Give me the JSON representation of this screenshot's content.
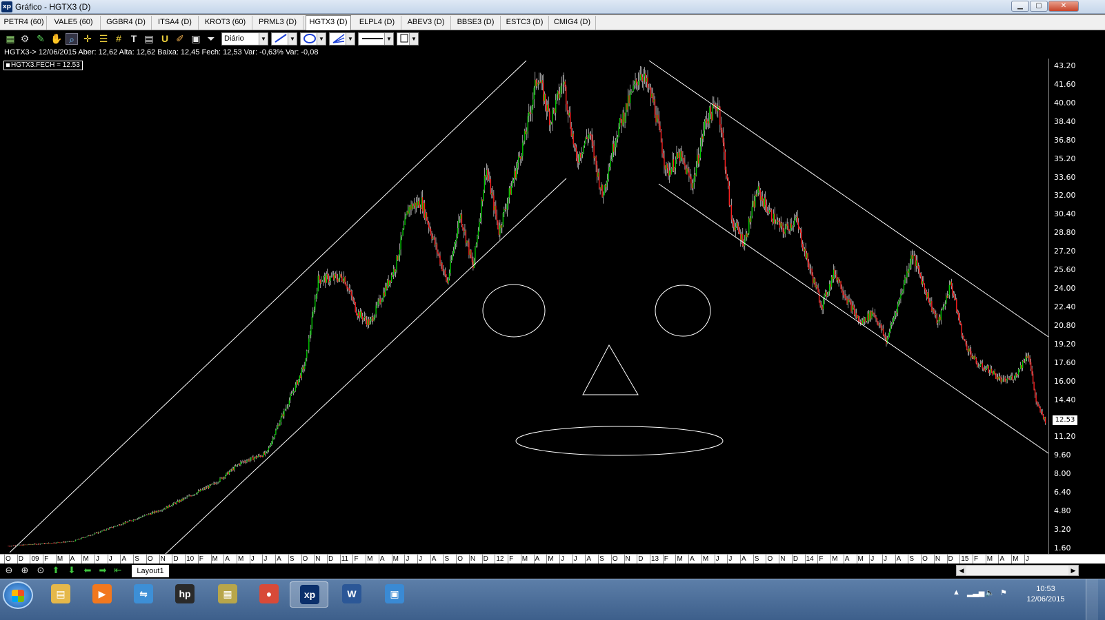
{
  "window": {
    "app_logo": "xp",
    "title": "Gráfico - HGTX3 (D)",
    "controls": [
      "minimize",
      "maximize",
      "close"
    ]
  },
  "tabs": [
    {
      "label": "PETR4 (60)",
      "active": false
    },
    {
      "label": "VALE5 (60)",
      "active": false
    },
    {
      "label": "GGBR4 (D)",
      "active": false
    },
    {
      "label": "ITSA4 (D)",
      "active": false
    },
    {
      "label": "KROT3 (60)",
      "active": false
    },
    {
      "label": "PRML3 (D)",
      "active": false
    },
    {
      "label": "HGTX3 (D)",
      "active": true
    },
    {
      "label": "ELPL4 (D)",
      "active": false
    },
    {
      "label": "ABEV3 (D)",
      "active": false
    },
    {
      "label": "BBSE3 (D)",
      "active": false
    },
    {
      "label": "ESTC3 (D)",
      "active": false
    },
    {
      "label": "CMIG4 (D)",
      "active": false
    }
  ],
  "toolbar": {
    "tools": [
      "chart-icon",
      "gear-icon",
      "pencil-icon",
      "hand-icon",
      "magnifier-icon",
      "crosshair-icon",
      "fibonacci-icon",
      "grid-icon",
      "text-icon",
      "calculator-icon",
      "magnet-icon",
      "brush-icon",
      "clipboard-icon",
      "filter-icon"
    ],
    "periodicity": "Diário"
  },
  "chart": {
    "info_line": "HGTX3-> 12/06/2015 Aber: 12,62 Alta: 12,62 Baixa: 12,45 Fech: 12,53 Var: -0,63% Var: -0,08",
    "legend": "HGTX3.FECH = 12.53",
    "last_price": "12.53",
    "colors": {
      "up": "#00cc00",
      "down": "#ff2020",
      "drawing": "#ffffff",
      "background": "#000000"
    }
  },
  "chart_data": {
    "type": "candlestick",
    "symbol": "HGTX3",
    "periodicity": "Diário",
    "ylim": [
      1.6,
      43.2
    ],
    "y_ticks": [
      "43.20",
      "41.60",
      "40.00",
      "38.40",
      "36.80",
      "35.20",
      "33.60",
      "32.00",
      "30.40",
      "28.80",
      "27.20",
      "25.60",
      "24.00",
      "22.40",
      "20.80",
      "19.20",
      "17.60",
      "16.00",
      "14.40",
      "12.80",
      "11.20",
      "9.60",
      "8.00",
      "6.40",
      "4.80",
      "3.20",
      "1.60"
    ],
    "x_ticks": [
      "O",
      "D",
      "09",
      "F",
      "M",
      "A",
      "M",
      "J",
      "J",
      "A",
      "S",
      "O",
      "N",
      "D",
      "10",
      "F",
      "M",
      "A",
      "M",
      "J",
      "J",
      "A",
      "S",
      "O",
      "N",
      "D",
      "11",
      "F",
      "M",
      "A",
      "M",
      "J",
      "J",
      "A",
      "S",
      "O",
      "N",
      "D",
      "12",
      "F",
      "M",
      "A",
      "M",
      "J",
      "J",
      "A",
      "S",
      "O",
      "N",
      "D",
      "13",
      "F",
      "M",
      "A",
      "M",
      "J",
      "J",
      "A",
      "S",
      "O",
      "N",
      "D",
      "14",
      "F",
      "M",
      "A",
      "M",
      "J",
      "J",
      "A",
      "S",
      "O",
      "N",
      "D",
      "15",
      "F",
      "M",
      "A",
      "M",
      "J"
    ],
    "x_start": "2008-10",
    "approx_close_path": [
      {
        "date": "2008-10",
        "close": 1.8
      },
      {
        "date": "2009-03",
        "close": 2.2
      },
      {
        "date": "2009-07",
        "close": 3.8
      },
      {
        "date": "2009-10",
        "close": 5.0
      },
      {
        "date": "2010-02",
        "close": 7.2
      },
      {
        "date": "2010-04",
        "close": 9.0
      },
      {
        "date": "2010-06",
        "close": 9.8
      },
      {
        "date": "2010-07",
        "close": 12.5
      },
      {
        "date": "2010-09",
        "close": 17.5
      },
      {
        "date": "2010-10",
        "close": 24.8
      },
      {
        "date": "2010-12",
        "close": 25.0
      },
      {
        "date": "2011-01",
        "close": 22.0
      },
      {
        "date": "2011-02",
        "close": 21.0
      },
      {
        "date": "2011-04",
        "close": 26.0
      },
      {
        "date": "2011-05",
        "close": 31.0
      },
      {
        "date": "2011-06",
        "close": 31.5
      },
      {
        "date": "2011-08",
        "close": 24.5
      },
      {
        "date": "2011-09",
        "close": 30.5
      },
      {
        "date": "2011-10",
        "close": 25.8
      },
      {
        "date": "2011-11",
        "close": 34.5
      },
      {
        "date": "2011-12",
        "close": 29.0
      },
      {
        "date": "2012-02",
        "close": 37.0
      },
      {
        "date": "2012-03",
        "close": 42.5
      },
      {
        "date": "2012-04",
        "close": 38.5
      },
      {
        "date": "2012-05",
        "close": 42.0
      },
      {
        "date": "2012-06",
        "close": 35.0
      },
      {
        "date": "2012-07",
        "close": 37.5
      },
      {
        "date": "2012-08",
        "close": 32.0
      },
      {
        "date": "2012-09",
        "close": 37.0
      },
      {
        "date": "2012-10",
        "close": 40.0
      },
      {
        "date": "2012-11",
        "close": 42.8
      },
      {
        "date": "2012-12",
        "close": 40.0
      },
      {
        "date": "2013-01",
        "close": 34.0
      },
      {
        "date": "2013-02",
        "close": 35.5
      },
      {
        "date": "2013-03",
        "close": 33.0
      },
      {
        "date": "2013-04",
        "close": 38.5
      },
      {
        "date": "2013-05",
        "close": 40.0
      },
      {
        "date": "2013-06",
        "close": 30.0
      },
      {
        "date": "2013-07",
        "close": 28.0
      },
      {
        "date": "2013-08",
        "close": 32.5
      },
      {
        "date": "2013-09",
        "close": 30.5
      },
      {
        "date": "2013-10",
        "close": 29.0
      },
      {
        "date": "2013-11",
        "close": 30.0
      },
      {
        "date": "2013-12",
        "close": 26.0
      },
      {
        "date": "2014-01",
        "close": 22.5
      },
      {
        "date": "2014-02",
        "close": 25.5
      },
      {
        "date": "2014-03",
        "close": 23.0
      },
      {
        "date": "2014-04",
        "close": 21.0
      },
      {
        "date": "2014-05",
        "close": 22.0
      },
      {
        "date": "2014-06",
        "close": 19.5
      },
      {
        "date": "2014-07",
        "close": 23.0
      },
      {
        "date": "2014-08",
        "close": 27.0
      },
      {
        "date": "2014-09",
        "close": 24.0
      },
      {
        "date": "2014-10",
        "close": 21.0
      },
      {
        "date": "2014-11",
        "close": 24.5
      },
      {
        "date": "2014-12",
        "close": 19.5
      },
      {
        "date": "2015-01",
        "close": 17.5
      },
      {
        "date": "2015-02",
        "close": 17.0
      },
      {
        "date": "2015-03",
        "close": 16.0
      },
      {
        "date": "2015-04",
        "close": 16.5
      },
      {
        "date": "2015-05",
        "close": 18.5
      },
      {
        "date": "2015-05-20",
        "close": 14.0
      },
      {
        "date": "2015-06-12",
        "close": 12.53
      }
    ],
    "grid": false,
    "drawings": [
      "upper channel line (rising)",
      "lower channel line (rising)",
      "upper channel line (falling)",
      "lower channel line (falling)",
      "left ellipse",
      "right ellipse",
      "triangle",
      "flat ellipse"
    ]
  },
  "bottom": {
    "nav_icons": [
      "zoom-out-icon",
      "zoom-in-icon",
      "zoom-fit-icon",
      "arrow-up-icon",
      "arrow-down-icon",
      "arrow-left-icon",
      "arrow-right-icon",
      "arrow-end-icon"
    ],
    "layout_tab": "Layout1"
  },
  "taskbar": {
    "apps": [
      {
        "name": "explorer",
        "glyph": "▤",
        "color": "#e5b84a"
      },
      {
        "name": "media-player",
        "glyph": "▶",
        "color": "#f2781e"
      },
      {
        "name": "network",
        "glyph": "⇋",
        "color": "#3d8fd6"
      },
      {
        "name": "hp",
        "glyph": "hp",
        "color": "#2a2a2a"
      },
      {
        "name": "scanner",
        "glyph": "▦",
        "color": "#b8a64a"
      },
      {
        "name": "chrome",
        "glyph": "●",
        "color": "#d84a38"
      },
      {
        "name": "xp",
        "glyph": "xp",
        "color": "#0a2f6b"
      },
      {
        "name": "word",
        "glyph": "W",
        "color": "#2b5797"
      },
      {
        "name": "photos",
        "glyph": "▣",
        "color": "#3a8ad4"
      }
    ],
    "time": "10:53",
    "date": "12/06/2015"
  }
}
